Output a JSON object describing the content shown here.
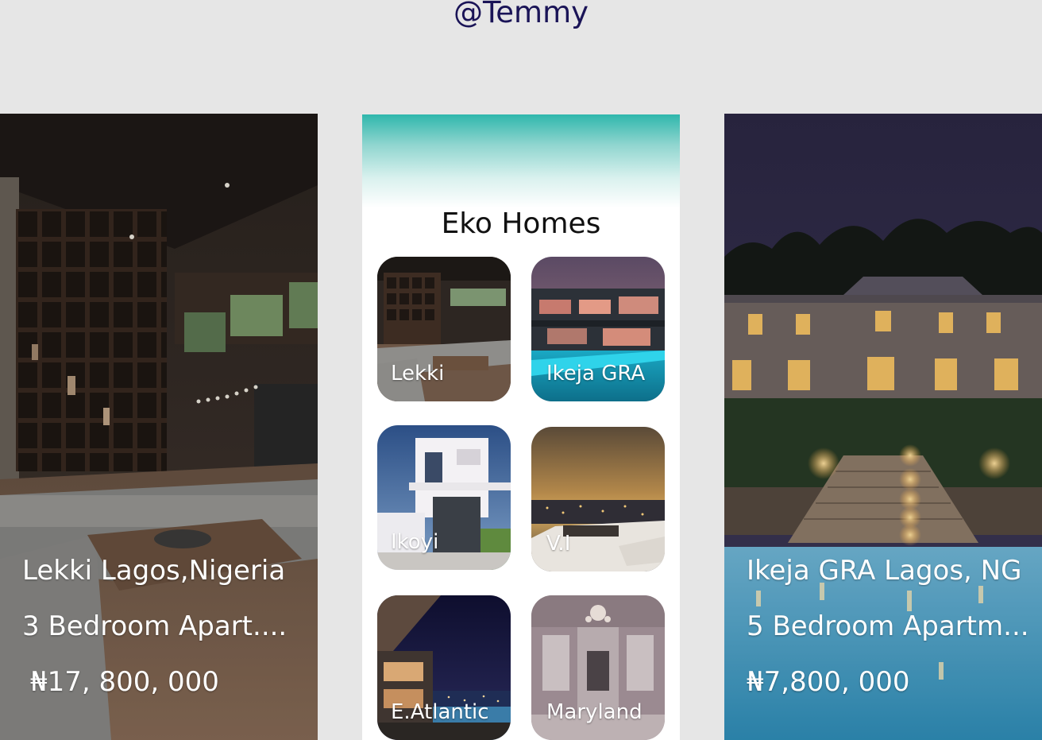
{
  "header": {
    "handle": "@Temmy"
  },
  "listings": [
    {
      "location": "Lekki Lagos,Nigeria",
      "bedrooms": "3 Bedroom Apart....",
      "price": "₦17, 800, 000"
    },
    {
      "location": "Ikeja GRA Lagos, NG",
      "bedrooms": "5 Bedroom Apartm...",
      "price": "₦7,800, 000"
    }
  ],
  "app": {
    "title": "Eko Homes",
    "areas": [
      {
        "label": "Lekki"
      },
      {
        "label": "Ikeja GRA"
      },
      {
        "label": "Ikoyi"
      },
      {
        "label": "V.I"
      },
      {
        "label": "E.Atlantic"
      },
      {
        "label": "Maryland"
      }
    ]
  },
  "colors": {
    "accent_teal": "#2fb7ac",
    "handle_text": "#1a1457",
    "background": "#e6e6e6"
  }
}
